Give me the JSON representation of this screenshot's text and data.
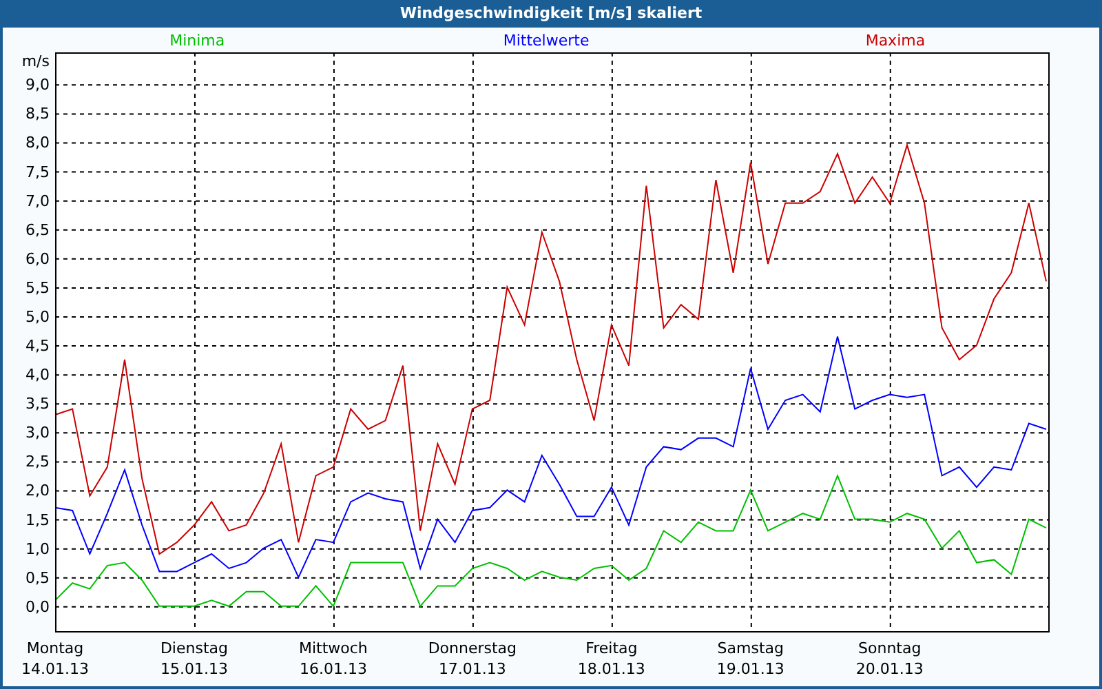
{
  "window": {
    "title": "Windgeschwindigkeit [m/s] skaliert"
  },
  "chart": {
    "chart_data": {
      "type": "line",
      "ylabel": "m/s",
      "categories": [
        "Montag\n14.01.13",
        null,
        null,
        null,
        null,
        null,
        null,
        null,
        "Dienstag\n15.01.13",
        null,
        null,
        null,
        null,
        null,
        null,
        null,
        "Mittwoch\n16.01.13",
        null,
        null,
        null,
        null,
        null,
        null,
        null,
        "Donnerstag\n17.01.13",
        null,
        null,
        null,
        null,
        null,
        null,
        null,
        "Freitag\n18.01.13",
        null,
        null,
        null,
        null,
        null,
        null,
        null,
        "Samstag\n19.01.13",
        null,
        null,
        null,
        null,
        null,
        null,
        null,
        "Sonntag\n20.01.13",
        null,
        null,
        null,
        null,
        null,
        null,
        null,
        null,
        null
      ],
      "series": [
        {
          "name": "Minima",
          "color": "#00c000",
          "values": [
            0.1,
            0.4,
            0.3,
            0.7,
            0.75,
            0.45,
            0,
            0,
            0,
            0.1,
            0,
            0.25,
            0.25,
            0,
            0,
            0.35,
            0,
            0.75,
            0.75,
            0.75,
            0.75,
            0,
            0.35,
            0.35,
            0.65,
            0.75,
            0.65,
            0.45,
            0.6,
            0.5,
            0.45,
            0.65,
            0.7,
            0.45,
            0.65,
            1.3,
            1.1,
            1.45,
            1.3,
            1.3,
            2.0,
            1.3,
            1.45,
            1.6,
            1.5,
            2.25,
            1.5,
            1.5,
            1.45,
            1.6,
            1.5,
            1.0,
            1.3,
            0.75,
            0.8,
            0.55,
            1.5,
            1.35
          ]
        },
        {
          "name": "Mittelwerte",
          "color": "#0000ff",
          "values": [
            1.7,
            1.65,
            0.9,
            1.6,
            2.35,
            1.4,
            0.6,
            0.6,
            0.75,
            0.9,
            0.65,
            0.75,
            1.0,
            1.15,
            0.5,
            1.15,
            1.1,
            1.8,
            1.95,
            1.85,
            1.8,
            0.65,
            1.5,
            1.1,
            1.65,
            1.7,
            2.0,
            1.8,
            2.6,
            2.1,
            1.55,
            1.55,
            2.05,
            1.4,
            2.4,
            2.75,
            2.7,
            2.9,
            2.9,
            2.75,
            4.1,
            3.05,
            3.55,
            3.65,
            3.35,
            4.65,
            3.4,
            3.55,
            3.65,
            3.6,
            3.65,
            2.25,
            2.4,
            2.05,
            2.4,
            2.35,
            3.15,
            3.05
          ]
        },
        {
          "name": "Maxima",
          "color": "#cc0000",
          "values": [
            3.3,
            3.4,
            1.9,
            2.4,
            4.25,
            2.2,
            0.9,
            1.1,
            1.4,
            1.8,
            1.3,
            1.4,
            1.95,
            2.8,
            1.1,
            2.25,
            2.4,
            3.4,
            3.05,
            3.2,
            4.15,
            1.3,
            2.8,
            2.1,
            3.4,
            3.55,
            5.5,
            4.85,
            6.45,
            5.6,
            4.25,
            3.2,
            4.85,
            4.15,
            7.25,
            4.8,
            5.2,
            4.95,
            7.35,
            5.75,
            7.65,
            5.9,
            6.95,
            6.95,
            7.15,
            7.8,
            6.95,
            7.4,
            6.95,
            7.95,
            6.95,
            4.8,
            4.25,
            4.5,
            5.3,
            5.75,
            6.95,
            5.6
          ]
        }
      ],
      "grid": true,
      "ylim": [
        -0.43,
        9.55
      ],
      "yticks": [
        {
          "value": 0,
          "label": "0,0"
        },
        {
          "value": 0.5,
          "label": "0,5"
        },
        {
          "value": 1,
          "label": "1,0"
        },
        {
          "value": 1.5,
          "label": "1,5"
        },
        {
          "value": 2,
          "label": "2,0"
        },
        {
          "value": 2.5,
          "label": "2,5"
        },
        {
          "value": 3,
          "label": "3,0"
        },
        {
          "value": 3.5,
          "label": "3,5"
        },
        {
          "value": 4,
          "label": "4,0"
        },
        {
          "value": 4.5,
          "label": "4,5"
        },
        {
          "value": 5,
          "label": "5,0"
        },
        {
          "value": 5.5,
          "label": "5,5"
        },
        {
          "value": 6,
          "label": "6,0"
        },
        {
          "value": 6.5,
          "label": "6,5"
        },
        {
          "value": 7,
          "label": "7,0"
        },
        {
          "value": 7.5,
          "label": "7,5"
        },
        {
          "value": 8,
          "label": "8,0"
        },
        {
          "value": 8.5,
          "label": "8,5"
        },
        {
          "value": 9,
          "label": "9,0"
        }
      ]
    }
  }
}
